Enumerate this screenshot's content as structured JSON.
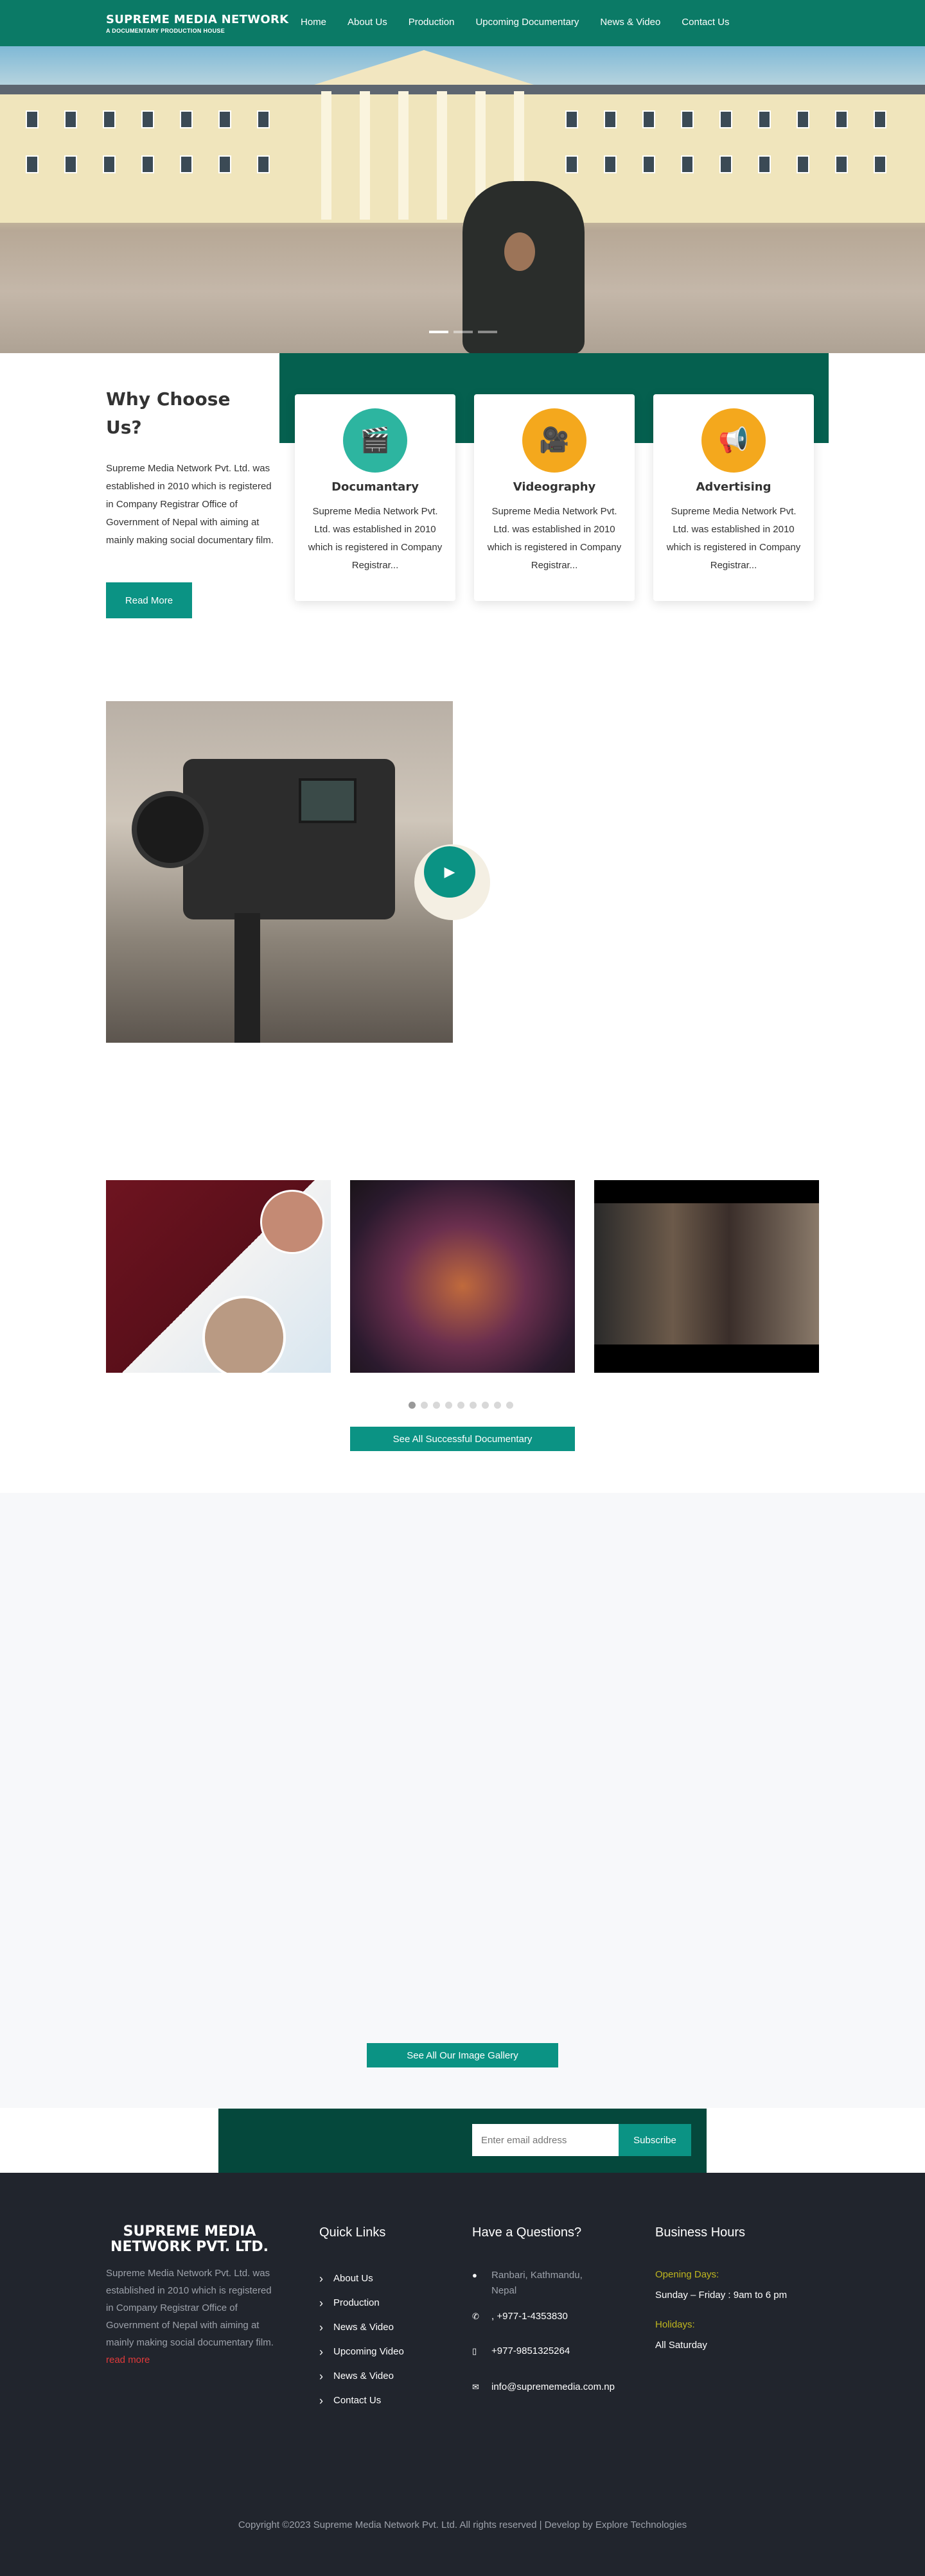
{
  "brand": {
    "title": "SUPREME MEDIA NETWORK",
    "subtitle": "A DOCUMENTARY PRODUCTION HOUSE"
  },
  "nav": [
    "Home",
    "About Us",
    "Production",
    "Upcoming Documentary",
    "News & Video",
    "Contact Us"
  ],
  "why": {
    "heading": "Why Choose Us?",
    "text": "Supreme Media Network Pvt. Ltd. was established in 2010 which is registered in Company Registrar Office of Government of Nepal with aiming at mainly making social documentary film.",
    "button": "Read More"
  },
  "cards": [
    {
      "title": "Documantary",
      "text": "Supreme Media Network Pvt. Ltd. was established in 2010 which is registered in Company Registrar...",
      "icon": "clapperboard-icon",
      "color": "#2db5a0"
    },
    {
      "title": "Videography",
      "text": "Supreme Media Network Pvt. Ltd. was established in 2010 which is registered in Company Registrar...",
      "icon": "video-camera-icon",
      "color": "#f4a81d"
    },
    {
      "title": "Advertising",
      "text": "Supreme Media Network Pvt. Ltd. was established in 2010 which is registered in Company Registrar...",
      "icon": "megaphone-icon",
      "color": "#f4a81d"
    }
  ],
  "documentaries": {
    "button": "See All Successful Documentary"
  },
  "gallery": {
    "button": "See All Our Image Gallery"
  },
  "subscribe": {
    "placeholder": "Enter email address",
    "button": "Subscribe"
  },
  "footer": {
    "brand": "SUPREME MEDIA NETWORK PVT. LTD.",
    "about": "Supreme Media Network Pvt. Ltd. was established in 2010 which is registered in Company Registrar Office of Government of Nepal with aiming at mainly making social documentary film.",
    "read_more": "read more",
    "quick_links_title": "Quick Links",
    "quick_links": [
      "About Us",
      "Production",
      "News & Video",
      "Upcoming Video",
      "News & Video",
      "Contact Us"
    ],
    "questions_title": "Have a Questions?",
    "address": "Ranbari, Kathmandu, Nepal",
    "phone": ", +977-1-4353830",
    "mobile": "+977-9851325264",
    "email": "info@suprememedia.com.np",
    "hours_title": "Business Hours",
    "opening_label": "Opening Days:",
    "opening_value": "Sunday – Friday : 9am to 6 pm",
    "holidays_label": "Holidays:",
    "holidays_value": "All Saturday",
    "copyright": "Copyright ©2023 Supreme Media Network Pvt. Ltd. All rights reserved | Develop by Explore Technologies"
  }
}
